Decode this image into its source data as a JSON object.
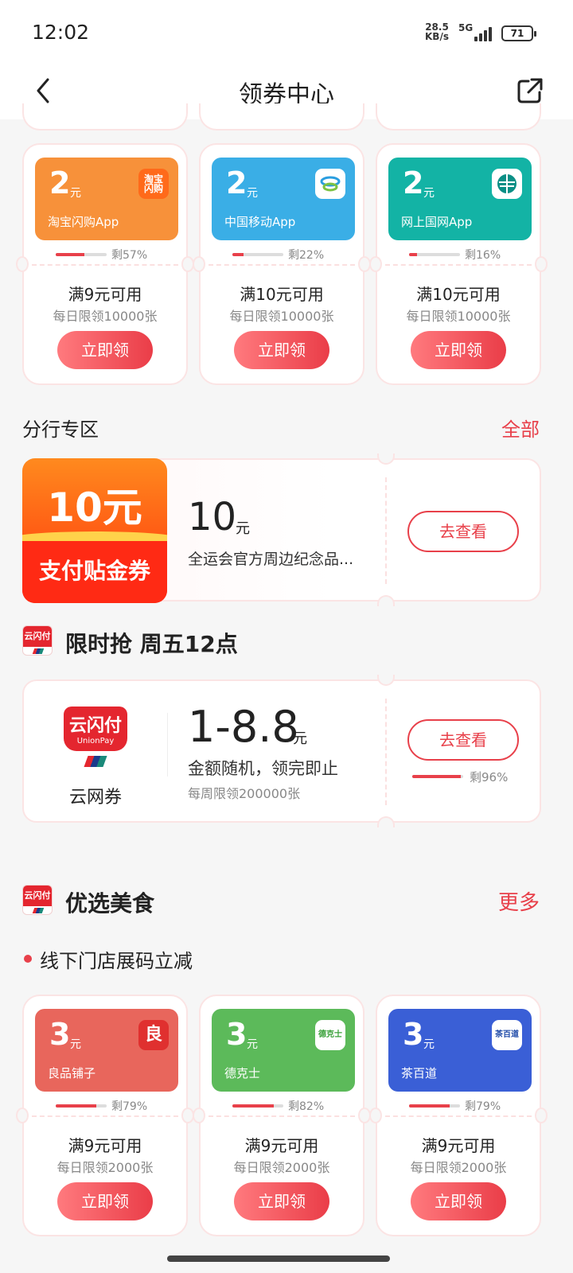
{
  "status_bar": {
    "time": "12:02",
    "net_speed": "28.5",
    "net_unit": "KB/s",
    "network": "5G",
    "battery": "71"
  },
  "nav": {
    "title": "领券中心"
  },
  "top_coupons": [
    {
      "amount": "2",
      "unit": "元",
      "brand": "淘宝闪购App",
      "logo": "淘宝闪购",
      "color": "#f7913a",
      "remain_pct": 0.57,
      "remain_text": "剩57%",
      "condition": "满9元可用",
      "limit": "每日限领10000张",
      "button": "立即领"
    },
    {
      "amount": "2",
      "unit": "元",
      "brand": "中国移动App",
      "logo": "移动",
      "color": "#3aaee6",
      "remain_pct": 0.22,
      "remain_text": "剩22%",
      "condition": "满10元可用",
      "limit": "每日限领10000张",
      "button": "立即领"
    },
    {
      "amount": "2",
      "unit": "元",
      "brand": "网上国网App",
      "logo": "国网",
      "color": "#13b3a5",
      "remain_pct": 0.16,
      "remain_text": "剩16%",
      "condition": "满10元可用",
      "limit": "每日限领10000张",
      "button": "立即领"
    }
  ],
  "branch": {
    "title": "分行专区",
    "all_label": "全部",
    "image_big": "10元",
    "image_sub": "支付贴金券",
    "amount": "10",
    "unit": "元",
    "desc": "全运会官方周边纪念品...",
    "button": "去查看"
  },
  "flash": {
    "logo_text": "云闪付",
    "title": "限时抢 周五12点",
    "logo_big": "云闪付",
    "logo_sub": "UnionPay",
    "logo_name": "云网券",
    "range": "1-8.8",
    "unit": "元",
    "desc": "金额随机，领完即止",
    "limit": "每周限领200000张",
    "button": "去查看",
    "remain_pct": 0.96,
    "remain_text": "剩96%"
  },
  "food": {
    "logo_text": "云闪付",
    "title": "优选美食",
    "more_label": "更多",
    "subtitle": "线下门店展码立减",
    "coupons": [
      {
        "amount": "3",
        "unit": "元",
        "brand": "良品铺子",
        "logo": "良",
        "color": "#e8665c",
        "remain_pct": 0.79,
        "remain_text": "剩79%",
        "condition": "满9元可用",
        "limit": "每日限领2000张",
        "button": "立即领"
      },
      {
        "amount": "3",
        "unit": "元",
        "brand": "德克士",
        "logo": "德克士",
        "color": "#5cba5a",
        "remain_pct": 0.82,
        "remain_text": "剩82%",
        "condition": "满9元可用",
        "limit": "每日限领2000张",
        "button": "立即领"
      },
      {
        "amount": "3",
        "unit": "元",
        "brand": "茶百道",
        "logo": "茶百道",
        "color": "#3a5fd6",
        "remain_pct": 0.79,
        "remain_text": "剩79%",
        "condition": "满9元可用",
        "limit": "每日限领2000张",
        "button": "立即领"
      }
    ]
  }
}
